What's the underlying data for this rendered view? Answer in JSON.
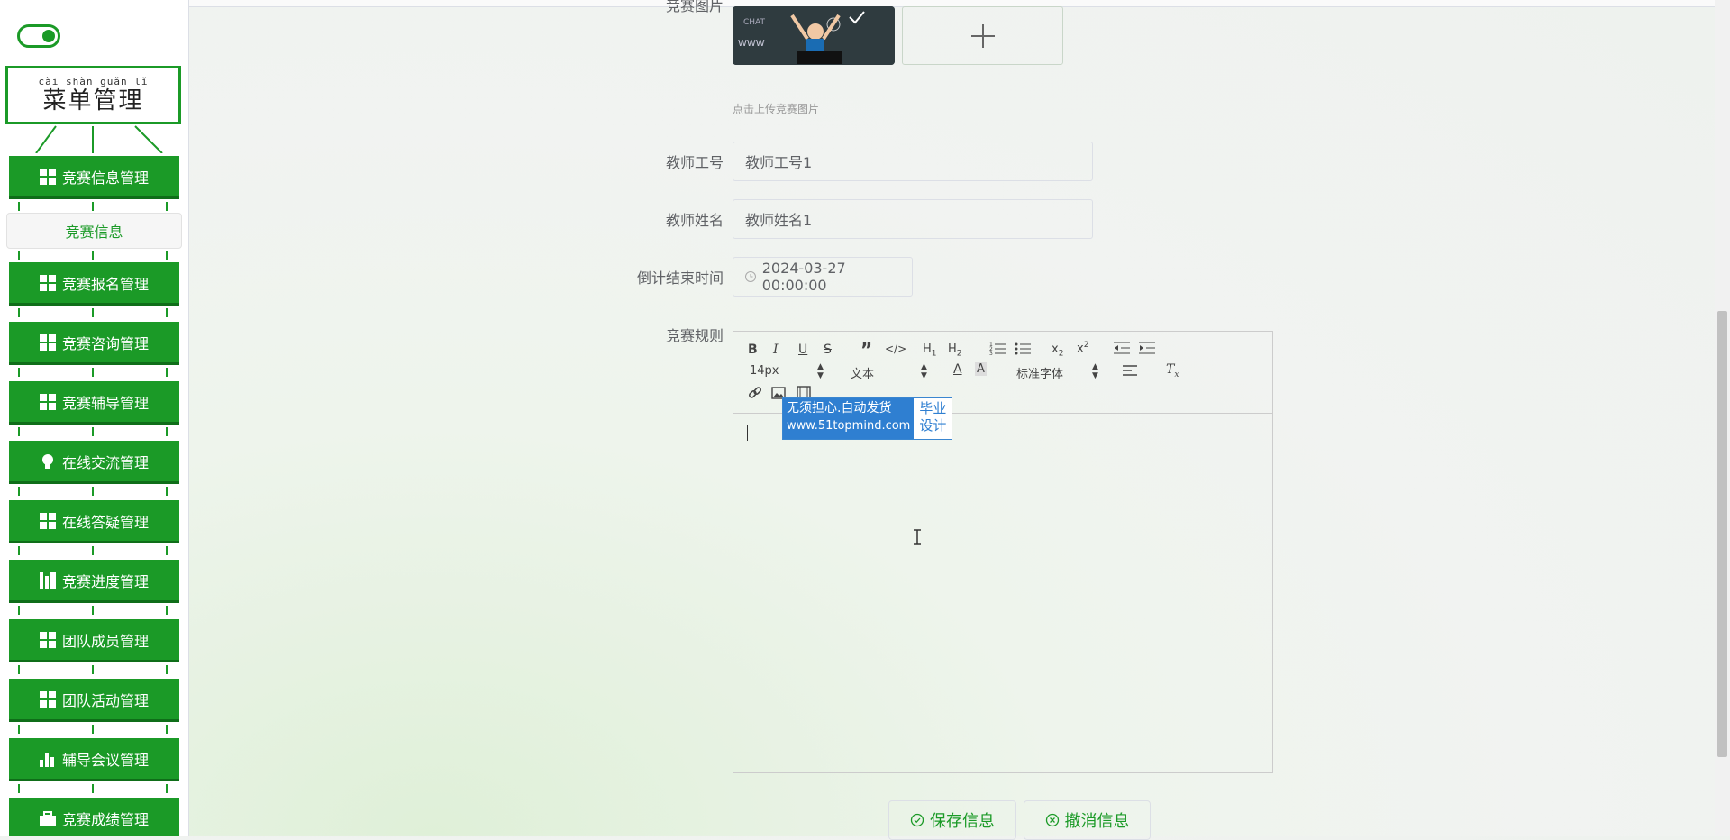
{
  "sidebar": {
    "menu_title_pinyin": "cài shàn guǎn lǐ",
    "menu_title": "菜单管理",
    "items": [
      {
        "label": "竞赛信息管理",
        "icon": "grid-icon"
      },
      {
        "label": "竞赛信息",
        "icon": ""
      },
      {
        "label": "竞赛报名管理",
        "icon": "grid-icon"
      },
      {
        "label": "竞赛咨询管理",
        "icon": "grid-icon"
      },
      {
        "label": "竞赛辅导管理",
        "icon": "grid-icon"
      },
      {
        "label": "在线交流管理",
        "icon": "bulb-icon"
      },
      {
        "label": "在线答疑管理",
        "icon": "grid-icon"
      },
      {
        "label": "竞赛进度管理",
        "icon": "bars-icon"
      },
      {
        "label": "团队成员管理",
        "icon": "grid-icon"
      },
      {
        "label": "团队活动管理",
        "icon": "grid-icon"
      },
      {
        "label": "辅导会议管理",
        "icon": "chart-icon"
      },
      {
        "label": "竞赛成绩管理",
        "icon": "briefcase-icon"
      }
    ]
  },
  "form": {
    "image_label": "竞赛图片",
    "upload_tip": "点击上传竞赛图片",
    "teacher_id_label": "教师工号",
    "teacher_id_value": "教师工号1",
    "teacher_name_label": "教师姓名",
    "teacher_name_value": "教师姓名1",
    "deadline_label": "倒计结束时间",
    "deadline_value": "2024-03-27 00:00:00",
    "rules_label": "竞赛规则"
  },
  "editor": {
    "font_size": "14px",
    "text_type": "文本",
    "font_family": "标准字体"
  },
  "watermark": {
    "line1": "无须担心.自动发货",
    "line2": "www.51topmind.com",
    "right1": "毕业",
    "right2": "设计"
  },
  "buttons": {
    "save": "保存信息",
    "cancel": "撤消信息"
  },
  "colors": {
    "primary": "#1b9a27",
    "primary_dark": "#0f6e19",
    "watermark_blue": "#2f7fd1"
  }
}
